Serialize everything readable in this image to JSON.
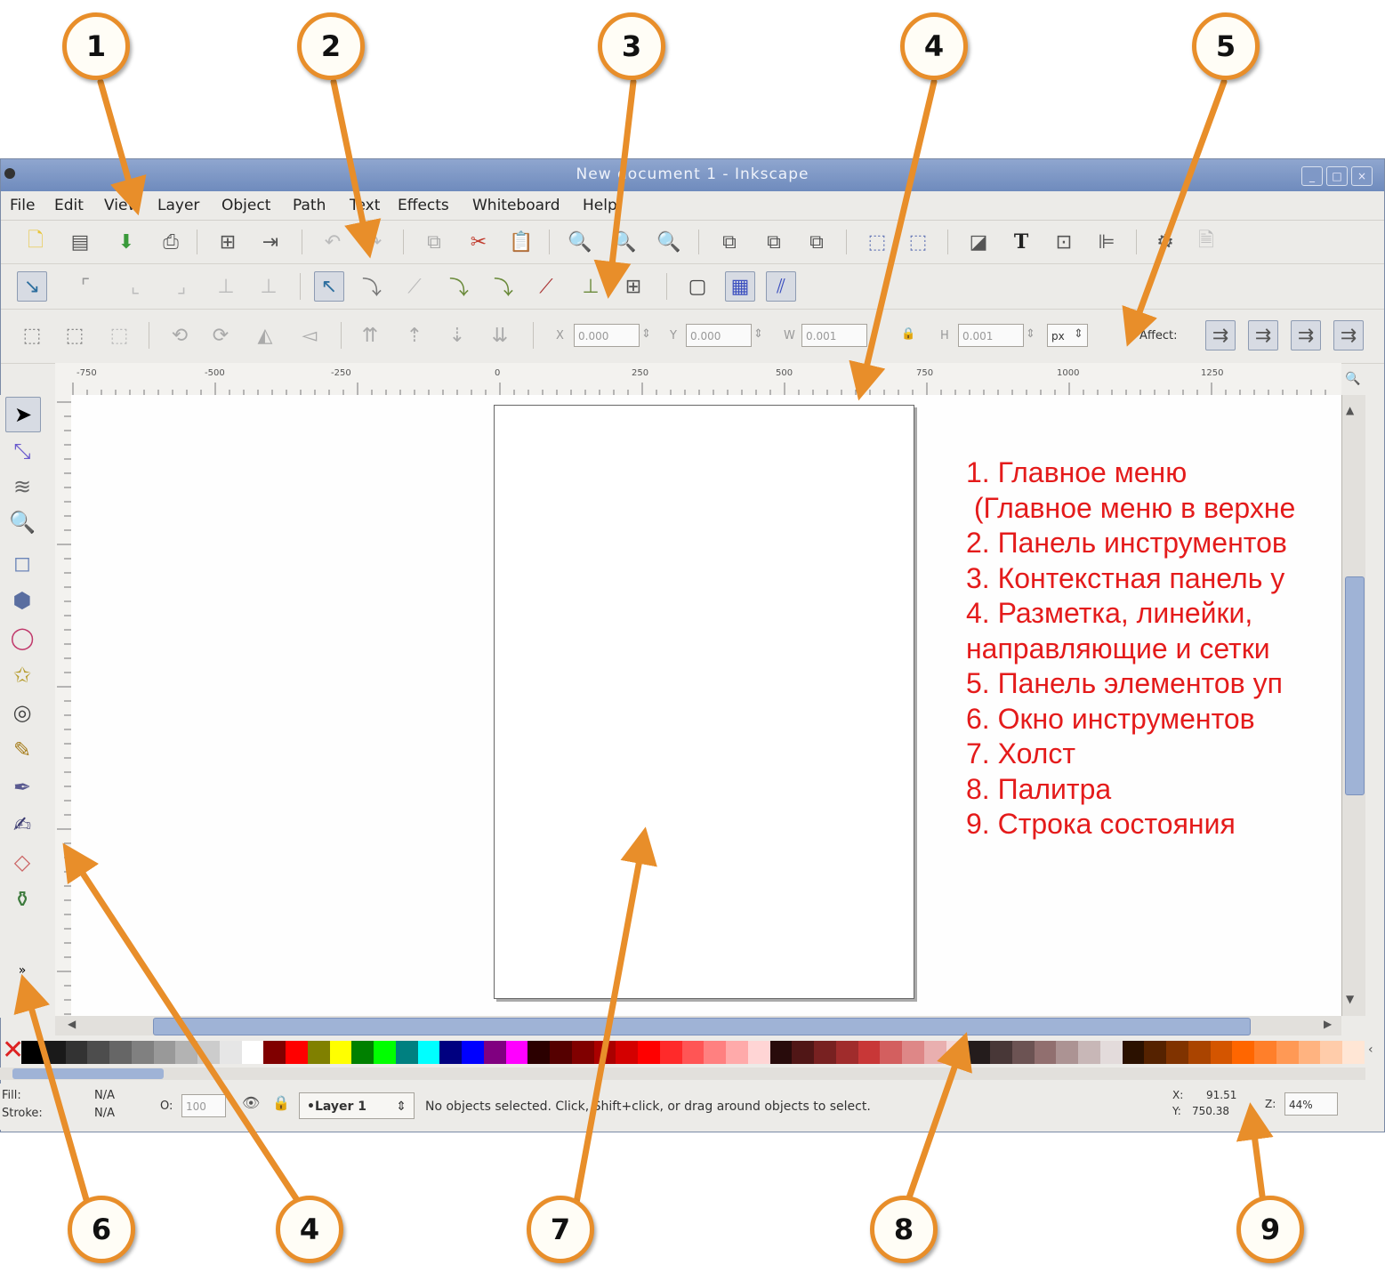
{
  "window": {
    "title": "New document 1 - Inkscape",
    "controls": [
      "_",
      "□",
      "×"
    ]
  },
  "menu": [
    "File",
    "Edit",
    "View",
    "Layer",
    "Object",
    "Path",
    "Text",
    "Effects",
    "Whiteboard",
    "Help"
  ],
  "toolbar_coords": {
    "x_label": "X",
    "x_value": "0.000",
    "y_label": "Y",
    "y_value": "0.000",
    "w_label": "W",
    "w_value": "0.001",
    "h_label": "H",
    "h_value": "0.001",
    "unit": "px",
    "affect_label": "Affect:"
  },
  "ruler": {
    "labels": [
      "-750",
      "-500",
      "-250",
      "0",
      "250",
      "500",
      "750",
      "1000",
      "1250"
    ]
  },
  "status": {
    "fill_label": "Fill:",
    "fill_value": "N/A",
    "stroke_label": "Stroke:",
    "stroke_value": "N/A",
    "opacity_label": "O:",
    "opacity_value": "100",
    "layer": "•Layer 1",
    "message": "No objects selected. Click, Shift+click, or drag around objects to select.",
    "x_label": "X:",
    "x_value": "91.51",
    "y_label": "Y:",
    "y_value": "750.38",
    "zoom_label": "Z:",
    "zoom_value": "44%"
  },
  "legend": [
    "1. Главное меню",
    " (Главное меню в верхне",
    "2. Панель инструментов",
    "3. Контекстная панель у",
    "4. Разметка, линейки,",
    "направляющие и сетки",
    "5. Панель элементов уп",
    "6. Окно инструментов",
    "7. Холст",
    "8. Палитра",
    "9. Строка состояния"
  ],
  "callouts": [
    "1",
    "2",
    "3",
    "4",
    "5",
    "6",
    "4",
    "7",
    "8",
    "9"
  ],
  "colors": {
    "callout_ring": "#e88e2a",
    "legend_text": "#e41b1b",
    "palette": [
      "#000000",
      "#1a1a1a",
      "#333333",
      "#4d4d4d",
      "#666666",
      "#808080",
      "#999999",
      "#b3b3b3",
      "#cccccc",
      "#e6e6e6",
      "#ffffff",
      "#800000",
      "#ff0000",
      "#808000",
      "#ffff00",
      "#008000",
      "#00ff00",
      "#008080",
      "#00ffff",
      "#000080",
      "#0000ff",
      "#800080",
      "#ff00ff",
      "#2b0000",
      "#550000",
      "#800000",
      "#aa0000",
      "#d40000",
      "#ff0000",
      "#ff2a2a",
      "#ff5555",
      "#ff8080",
      "#ffaaaa",
      "#ffd5d5",
      "#280b0b",
      "#501616",
      "#782121",
      "#a02c2c",
      "#c83737",
      "#d35f5f",
      "#de8787",
      "#e9afaf",
      "#f4d7d7",
      "#241c1c",
      "#483737",
      "#6c5353",
      "#916f6f",
      "#ac9393",
      "#c8b7b7",
      "#e3dbdb",
      "#2b1100",
      "#552200",
      "#803300",
      "#aa4400",
      "#d45500",
      "#ff6600",
      "#ff7f2a",
      "#ff9955",
      "#ffb380",
      "#ffccaa",
      "#ffe6d5"
    ]
  }
}
